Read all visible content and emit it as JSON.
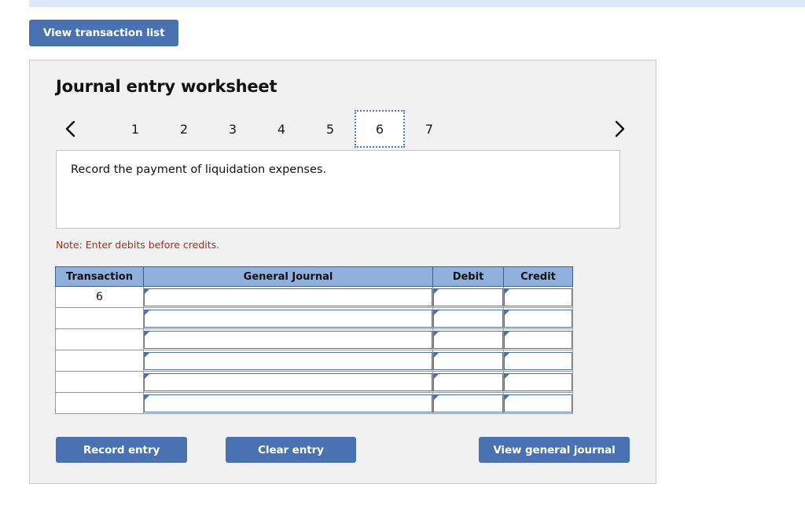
{
  "top_bar": {
    "accent_color": "#dce8f7"
  },
  "toolbar": {
    "view_transaction_list_label": "View transaction list"
  },
  "worksheet": {
    "title": "Journal entry worksheet",
    "pager": {
      "prev_icon": "chevron-left-icon",
      "next_icon": "chevron-right-icon",
      "pages": [
        "1",
        "2",
        "3",
        "4",
        "5",
        "6",
        "7"
      ],
      "active_page": "6"
    },
    "description": "Record the payment of liquidation expenses.",
    "note": "Note: Enter debits before credits.",
    "table": {
      "headers": [
        "Transaction",
        "General Journal",
        "Debit",
        "Credit"
      ],
      "rows": [
        {
          "transaction": "6",
          "general_journal": "",
          "debit": "",
          "credit": ""
        },
        {
          "transaction": "",
          "general_journal": "",
          "debit": "",
          "credit": ""
        },
        {
          "transaction": "",
          "general_journal": "",
          "debit": "",
          "credit": ""
        },
        {
          "transaction": "",
          "general_journal": "",
          "debit": "",
          "credit": ""
        },
        {
          "transaction": "",
          "general_journal": "",
          "debit": "",
          "credit": ""
        },
        {
          "transaction": "",
          "general_journal": "",
          "debit": "",
          "credit": ""
        }
      ]
    },
    "actions": {
      "record_entry_label": "Record entry",
      "clear_entry_label": "Clear entry",
      "view_general_journal_label": "View general journal"
    }
  },
  "colors": {
    "button_blue": "#4a72b2",
    "header_blue": "#8fb0dc",
    "note_red": "#a03027",
    "panel_gray": "#f1f1f1"
  }
}
